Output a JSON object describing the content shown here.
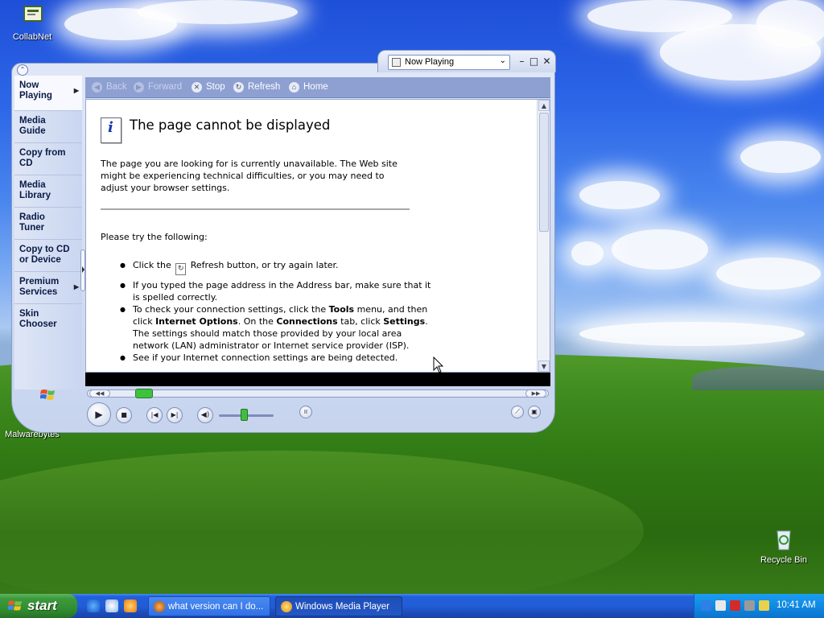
{
  "desktop": {
    "icons": [
      {
        "label": "CollabNet"
      },
      {
        "label": "Malwarebytes"
      },
      {
        "label": "Recycle Bin"
      }
    ]
  },
  "player": {
    "now_playing_dropdown": "Now Playing",
    "taskbar_items": [
      {
        "label": "Now Playing"
      },
      {
        "label": "Media Guide"
      },
      {
        "label": "Copy from CD"
      },
      {
        "label": "Media Library"
      },
      {
        "label": "Radio Tuner"
      },
      {
        "label": "Copy to CD or Device"
      },
      {
        "label": "Premium Services"
      },
      {
        "label": "Skin Chooser"
      }
    ],
    "nav": {
      "back": "Back",
      "forward": "Forward",
      "stop": "Stop",
      "refresh": "Refresh",
      "home": "Home"
    },
    "page": {
      "title": "The page cannot be displayed",
      "intro": "The page you are looking for is currently unavailable. The Web site might be experiencing technical difficulties, or you may need to adjust your browser settings.",
      "try_following": "Please try the following:",
      "tip1_pre": "Click the",
      "tip1_post": "Refresh button, or try again later.",
      "tip2": "If you typed the page address in the Address bar, make sure that it is spelled correctly.",
      "tip3_a": "To check your connection settings, click the ",
      "tip3_tools": "Tools",
      "tip3_b": " menu, and then click ",
      "tip3_io": "Internet Options",
      "tip3_c": ". On the ",
      "tip3_conn": "Connections",
      "tip3_d": " tab, click ",
      "tip3_settings": "Settings",
      "tip3_e": ". The settings should match those provided by your local area network (LAN) administrator or Internet service provider (ISP).",
      "tip4": "See if your Internet connection settings are being detected."
    },
    "seek_fraction": 0.06,
    "volume_fraction": 0.45
  },
  "taskbar": {
    "start_label": "start",
    "buttons": [
      {
        "label": "what version can I do...",
        "active": false
      },
      {
        "label": "Windows Media Player",
        "active": true
      }
    ],
    "clock": "10:41 AM"
  }
}
